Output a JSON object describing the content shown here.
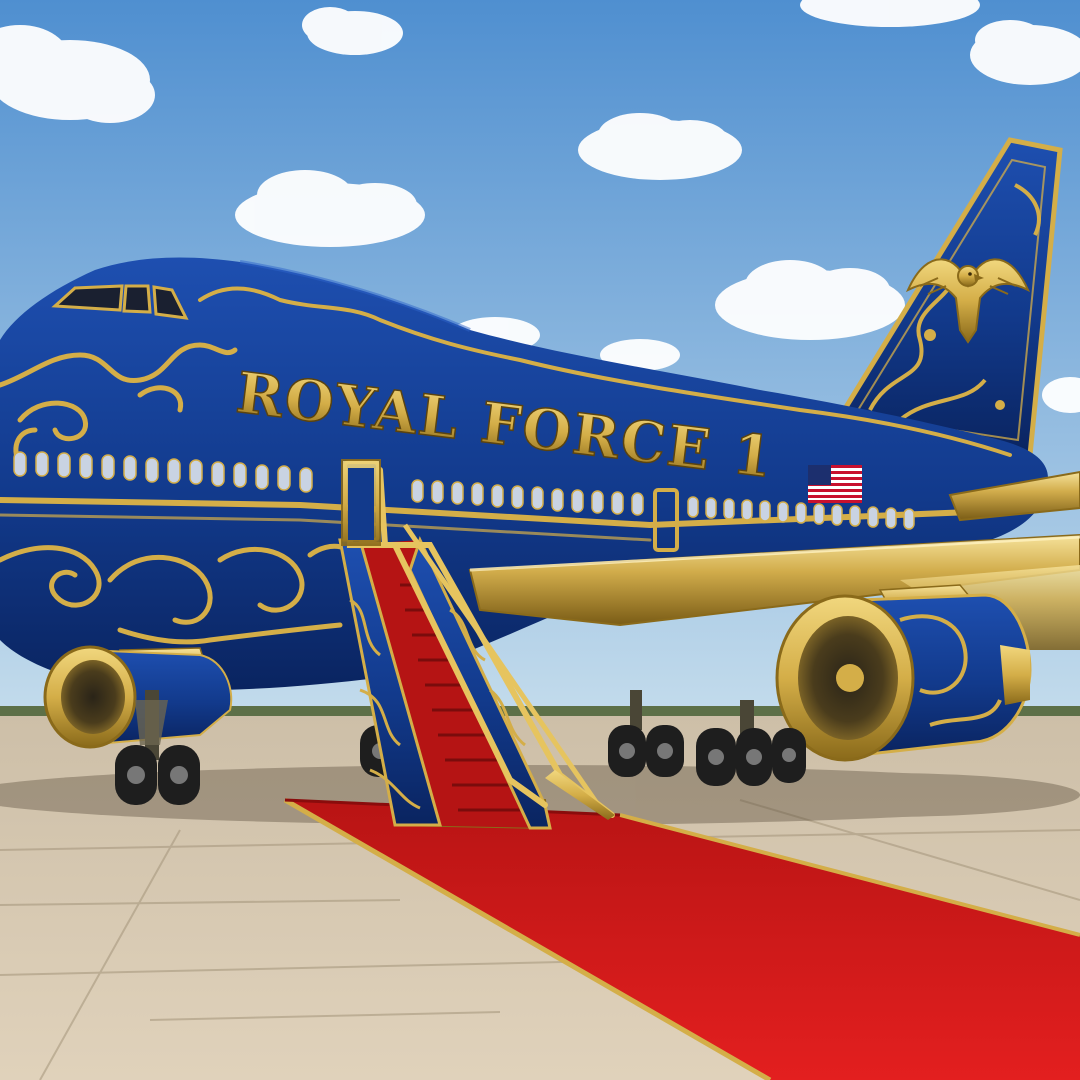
{
  "scene": {
    "livery_text": "ROYAL FORCE 1",
    "tail_emblem_icon": "eagle-icon",
    "flag_icon": "us-flag-icon"
  },
  "colors": {
    "sky_top": "#4f8fd0",
    "sky_bottom": "#c4dcec",
    "fuselage_blue": "#123a8c",
    "fuselage_dark": "#0a2460",
    "gold": "#d4ae48",
    "gold_light": "#f1d77e",
    "gold_dark": "#8a6a1a",
    "carpet_red": "#d41a1a",
    "tarmac": "#d9cab3"
  }
}
